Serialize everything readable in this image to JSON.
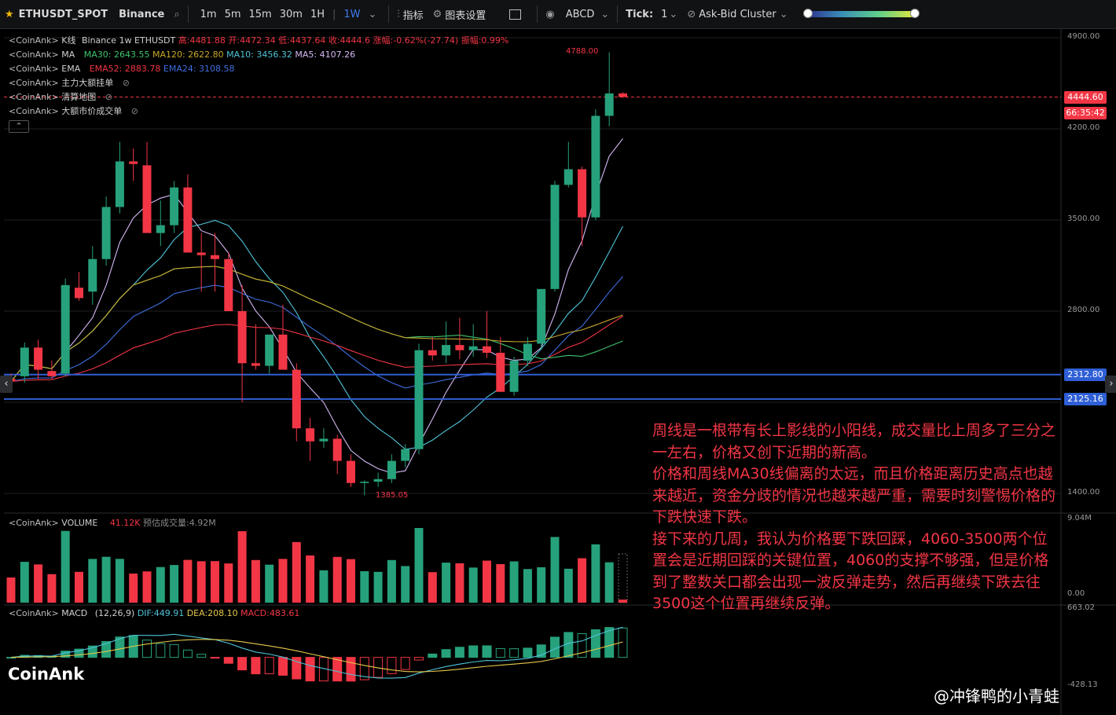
{
  "toolbar": {
    "symbol": "ETHUSDT_SPOT",
    "exchange": "Binance",
    "intervals": [
      "1m",
      "5m",
      "15m",
      "30m",
      "1H",
      "1W"
    ],
    "active_interval": "1W",
    "indicators_label": "指标",
    "settings_label": "图表设置",
    "abcd_label": "ABCD",
    "tick_label": "Tick:",
    "tick_value": "1",
    "cluster_label": "Ask-Bid Cluster"
  },
  "legend": {
    "kline": {
      "src": "<CoinAnk>",
      "name": "K线",
      "info": "Binance 1w ETHUSDT",
      "high": "高:4481.88",
      "open": "开:4472.34",
      "low": "低:4437.64",
      "close": "收:4444.6",
      "change": "涨幅:-0.62%(-27.74)",
      "amplitude": "振幅:0.99%"
    },
    "ma": {
      "src": "<CoinAnk>",
      "name": "MA",
      "ma30": "MA30: 2643.55",
      "ma120": "MA120: 2622.80",
      "ma10": "MA10: 3456.32",
      "ma5": "MA5: 4107.26"
    },
    "ema": {
      "src": "<CoinAnk>",
      "name": "EMA",
      "ema52": "EMA52: 2883.78",
      "ema24": "EMA24: 3108.58"
    },
    "main_orders": {
      "src": "<CoinAnk>",
      "name": "主力大额挂单"
    },
    "liq_map": {
      "src": "<CoinAnk>",
      "name": "清算地图"
    },
    "large_trades": {
      "src": "<CoinAnk>",
      "name": "大额市价成交单"
    },
    "volume": {
      "src": "<CoinAnk>",
      "name": "VOLUME",
      "value": "41.12K",
      "est": "预估成交量:4.92M"
    },
    "macd": {
      "src": "<CoinAnk>",
      "name": "MACD",
      "params": "(12,26,9)",
      "dif": "DIF:449.91",
      "dea": "DEA:208.10",
      "macd": "MACD:483.61"
    }
  },
  "price_axis": {
    "labels": [
      "4900.00",
      "4200.00",
      "3500.00",
      "2800.00",
      "1400.00"
    ],
    "current_price": "4444.60",
    "countdown": "66:35:42",
    "line1": "2312.80",
    "line2": "2125.16"
  },
  "volume_axis": {
    "labels": [
      "9.04M",
      "0.00"
    ]
  },
  "macd_axis": {
    "labels": [
      "663.02",
      "-428.13"
    ]
  },
  "annotations": {
    "high": "4788.00",
    "low": "1385.05"
  },
  "note": {
    "p1": "周线是一根带有长上影线的小阳线，成交量比上周多了三分之一左右，价格又创下近期的新高。",
    "p2": "价格和周线MA30线偏离的太远，而且价格距离历史高点也越来越近，资金分歧的情况也越来越严重，需要时刻警惕价格的下跌快速下跌。",
    "p3": "接下来的几周，我认为价格要下跌回踩，4060-3500两个位置会是近期回踩的关键位置，4060的支撑不够强，但是价格到了整数关口都会出现一波反弹走势，然后再继续下跌去往3500这个位置再继续反弹。"
  },
  "watermark": "CoinAnk",
  "credit": "@冲锋鸭的小青蛙",
  "colors": {
    "up": "#26a17b",
    "down": "#f23645",
    "bg": "#000000",
    "accent": "#3f7cf0",
    "hline": "#2f5fd6"
  },
  "chart_data": {
    "type": "candlestick",
    "interval": "1w",
    "ohlc": [
      [
        2280,
        2320,
        2230,
        2260
      ],
      [
        2300,
        2560,
        2250,
        2520
      ],
      [
        2520,
        2580,
        2280,
        2350
      ],
      [
        2340,
        2420,
        2280,
        2300
      ],
      [
        2320,
        3050,
        2300,
        3000
      ],
      [
        2980,
        3100,
        2880,
        2900
      ],
      [
        2950,
        3300,
        2850,
        3200
      ],
      [
        3200,
        3680,
        3150,
        3600
      ],
      [
        3600,
        4100,
        3550,
        3950
      ],
      [
        3950,
        4050,
        3800,
        3930
      ],
      [
        3920,
        4100,
        3800,
        3400
      ],
      [
        3400,
        3650,
        3300,
        3460
      ],
      [
        3460,
        3800,
        3400,
        3750
      ],
      [
        3750,
        3850,
        3300,
        3250
      ],
      [
        3250,
        3400,
        2950,
        3230
      ],
      [
        3230,
        3400,
        2950,
        3200
      ],
      [
        3200,
        3250,
        2850,
        2800
      ],
      [
        2800,
        3000,
        2100,
        2400
      ],
      [
        2400,
        2700,
        2350,
        2380
      ],
      [
        2380,
        2600,
        2320,
        2620
      ],
      [
        2620,
        2850,
        2450,
        2350
      ],
      [
        2350,
        2400,
        1800,
        1900
      ],
      [
        1900,
        1980,
        1650,
        1800
      ],
      [
        1800,
        1900,
        1750,
        1820
      ],
      [
        1820,
        1850,
        1550,
        1650
      ],
      [
        1650,
        1700,
        1450,
        1480
      ],
      [
        1480,
        1500,
        1385,
        1490
      ],
      [
        1490,
        1560,
        1450,
        1510
      ],
      [
        1510,
        1700,
        1480,
        1650
      ],
      [
        1650,
        1780,
        1600,
        1740
      ],
      [
        1740,
        2550,
        1700,
        2500
      ],
      [
        2500,
        2600,
        2420,
        2460
      ],
      [
        2460,
        2720,
        2400,
        2540
      ],
      [
        2540,
        2750,
        2430,
        2500
      ],
      [
        2500,
        2700,
        2450,
        2530
      ],
      [
        2530,
        2800,
        2440,
        2480
      ],
      [
        2480,
        2600,
        2300,
        2180
      ],
      [
        2180,
        2450,
        2150,
        2420
      ],
      [
        2420,
        2600,
        2380,
        2550
      ],
      [
        2550,
        2760,
        2500,
        2970
      ],
      [
        2970,
        3800,
        2950,
        3770
      ],
      [
        3770,
        4100,
        3750,
        3890
      ],
      [
        3890,
        3910,
        3300,
        3520
      ],
      [
        3520,
        4350,
        3500,
        4300
      ],
      [
        4300,
        4788,
        4220,
        4472
      ],
      [
        4472,
        4481.88,
        4437.64,
        4444.6
      ]
    ],
    "volume_max": 9.04,
    "price_range": [
      1300,
      5000
    ],
    "macd_range": [
      -428.13,
      663.02
    ]
  }
}
